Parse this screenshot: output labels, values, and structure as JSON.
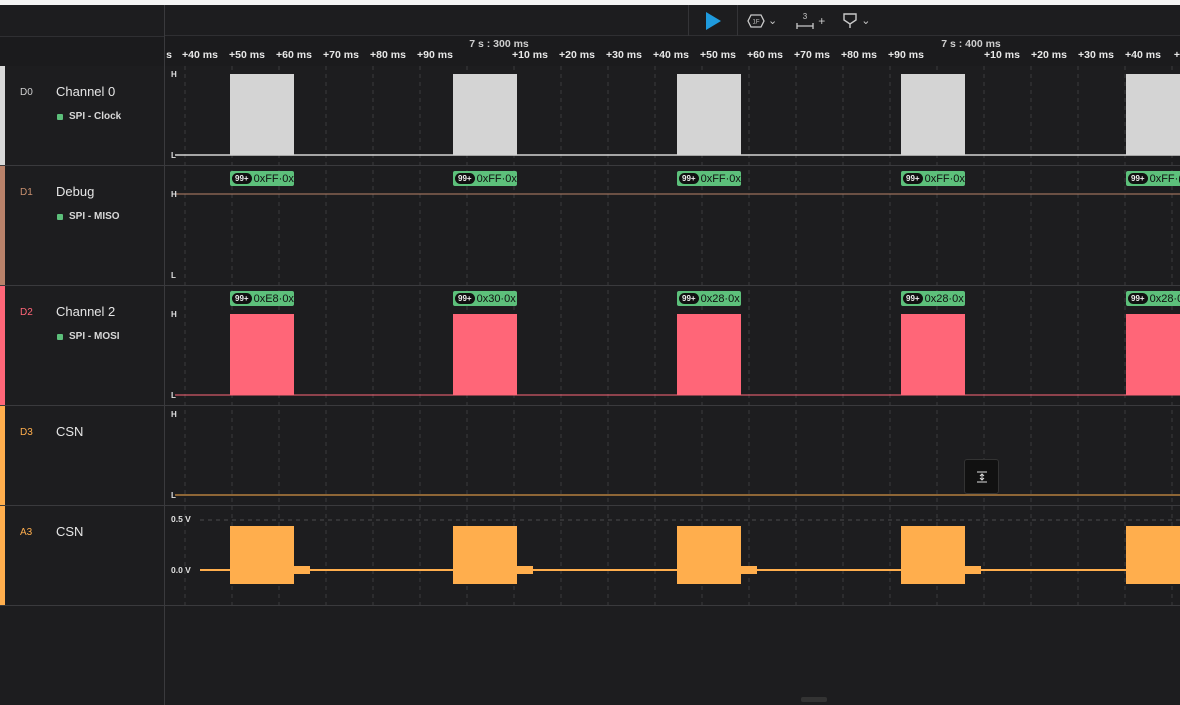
{
  "toolbar": {
    "items": [
      {
        "icon": "play-icon",
        "label": ""
      },
      {
        "icon": "trigger-mode-icon",
        "label": "⌄"
      },
      {
        "icon": "measure-icon",
        "label": "+"
      },
      {
        "icon": "marker-icon",
        "label": "⌄"
      }
    ],
    "measure_number": "3",
    "trigger_glyph": "1F",
    "accent": "#1f9bde"
  },
  "ruler": {
    "big_labels": [
      "7 s : 300 ms",
      "7 s : 400 ms"
    ],
    "ticks": [
      "s",
      "+40 ms",
      "+50 ms",
      "+60 ms",
      "+70 ms",
      "+80 ms",
      "+90 ms",
      "+10 ms",
      "+20 ms",
      "+30 ms",
      "+40 ms",
      "+50 ms",
      "+60 ms",
      "+70 ms",
      "+80 ms",
      "+90 ms",
      "+10 ms",
      "+20 ms",
      "+30 ms",
      "+40 ms",
      "+"
    ]
  },
  "channels": [
    {
      "id": "D0",
      "name": "Channel 0",
      "analyzer": "SPI - Clock",
      "color": "#d9d9d9",
      "id_color": "#d0d0d0"
    },
    {
      "id": "D1",
      "name": "Debug",
      "analyzer": "SPI - MISO",
      "color": "#b9826a",
      "id_color": "#c8906f"
    },
    {
      "id": "D2",
      "name": "Channel 2",
      "analyzer": "SPI - MOSI",
      "color": "#ff6678",
      "id_color": "#ff6678"
    },
    {
      "id": "D3",
      "name": "CSN",
      "analyzer": "",
      "color": "#ffae4d",
      "id_color": "#ffae4d"
    },
    {
      "id": "A3",
      "name": "CSN",
      "analyzer": "",
      "color": "#ffae4d",
      "id_color": "#ffae4d"
    }
  ],
  "levels": {
    "high": "H",
    "low": "L"
  },
  "analog": {
    "top_label": "0.5 V",
    "zero_label": "0.0 V"
  },
  "miso_decodes": [
    {
      "badge": "99+",
      "text": "0xFF·0x"
    },
    {
      "badge": "99+",
      "text": "0xFF·0x"
    },
    {
      "badge": "99+",
      "text": "0xFF·0x"
    },
    {
      "badge": "99+",
      "text": "0xFF·0x"
    },
    {
      "badge": "99+",
      "text": "0xFF·("
    }
  ],
  "mosi_decodes": [
    {
      "badge": "99+",
      "text": "0xE8·0x"
    },
    {
      "badge": "99+",
      "text": "0x30·0x"
    },
    {
      "badge": "99+",
      "text": "0x28·0x"
    },
    {
      "badge": "99+",
      "text": "0x28·0x"
    },
    {
      "badge": "99+",
      "text": "0x28·0"
    }
  ],
  "decode_color": "#5dc07b"
}
